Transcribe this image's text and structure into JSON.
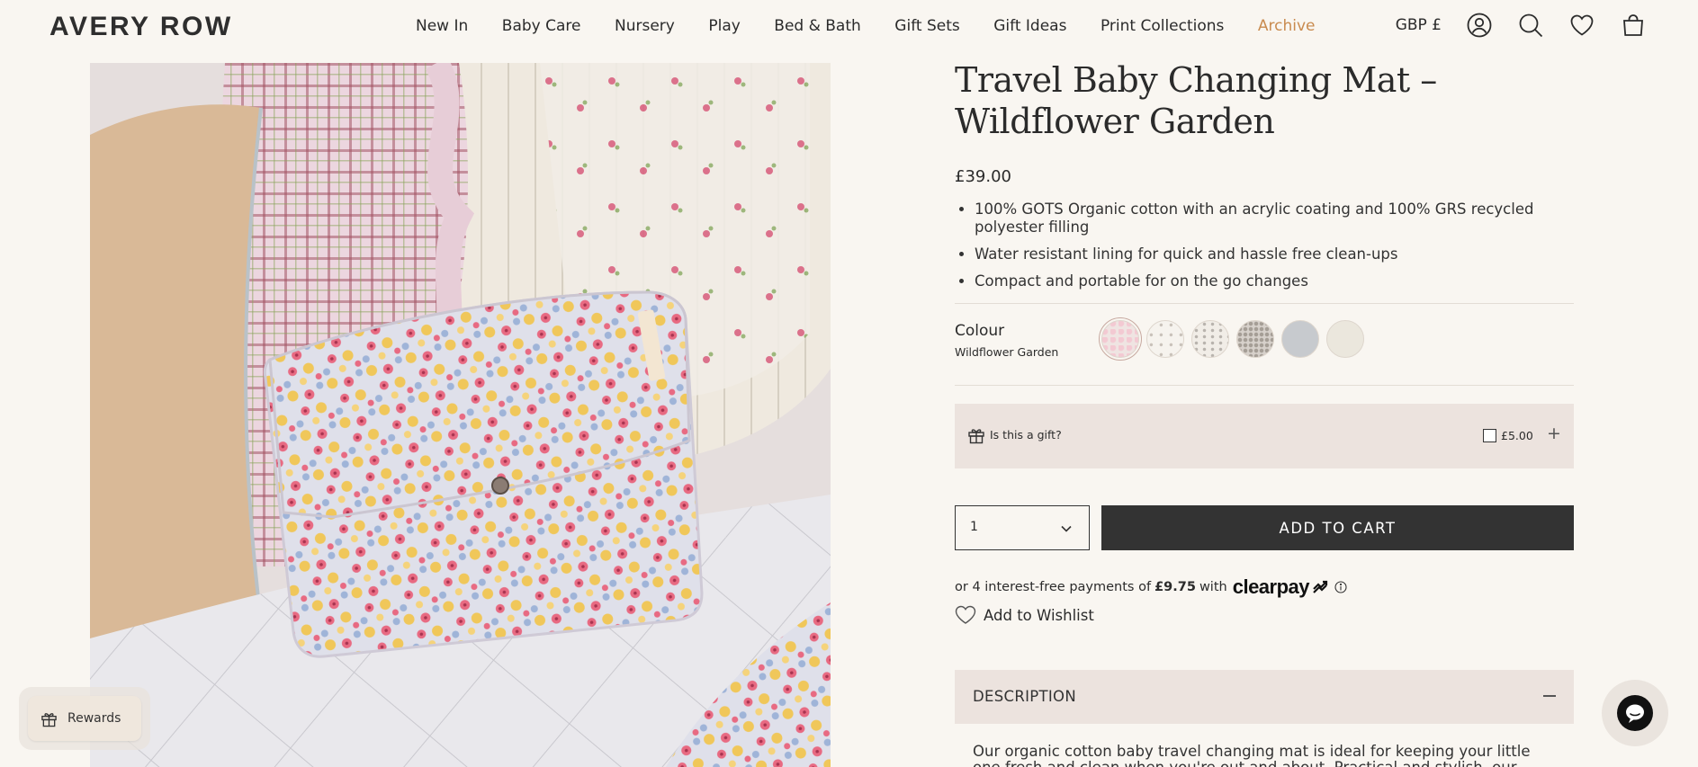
{
  "header": {
    "logo": "AVERY ROW",
    "nav": [
      {
        "label": "New In"
      },
      {
        "label": "Baby Care"
      },
      {
        "label": "Nursery"
      },
      {
        "label": "Play"
      },
      {
        "label": "Bed & Bath"
      },
      {
        "label": "Gift Sets"
      },
      {
        "label": "Gift Ideas"
      },
      {
        "label": "Print Collections"
      },
      {
        "label": "Archive"
      }
    ],
    "currency": "GBP £",
    "icons": [
      "account-icon",
      "search-icon",
      "heart-icon",
      "bag-icon"
    ],
    "highlight_color": "#c98b4f"
  },
  "product": {
    "title": "Travel Baby Changing Mat – Wildflower Garden",
    "price": "£39.00",
    "bullets": [
      "100% GOTS Organic cotton with an acrylic coating and 100% GRS recycled polyester filling",
      "Water resistant lining for quick and hassle free clean-ups",
      "Compact and portable for on the go changes"
    ],
    "colour": {
      "label": "Colour",
      "value": "Wildflower Garden",
      "swatches": 6,
      "selected_index": 0
    },
    "gift": {
      "label": "Is this a gift?",
      "price": "£5.00",
      "checked": false
    },
    "quantity": "1",
    "add_to_cart": "ADD TO CART",
    "clearpay": {
      "prefix": "or 4 interest-free payments of",
      "amount": "£9.75",
      "with": "with",
      "brand": "clearpay"
    },
    "wishlist": "Add to Wishlist",
    "description": {
      "heading": "DESCRIPTION",
      "text": "Our organic cotton baby travel changing mat is ideal for keeping your little one fresh and clean when you're out and about. Practical and stylish, our travel mats"
    }
  },
  "widgets": {
    "rewards": "Rewards"
  },
  "colors": {
    "background": "#f9f6f1",
    "panel": "#ece3de",
    "button": "#333333"
  }
}
